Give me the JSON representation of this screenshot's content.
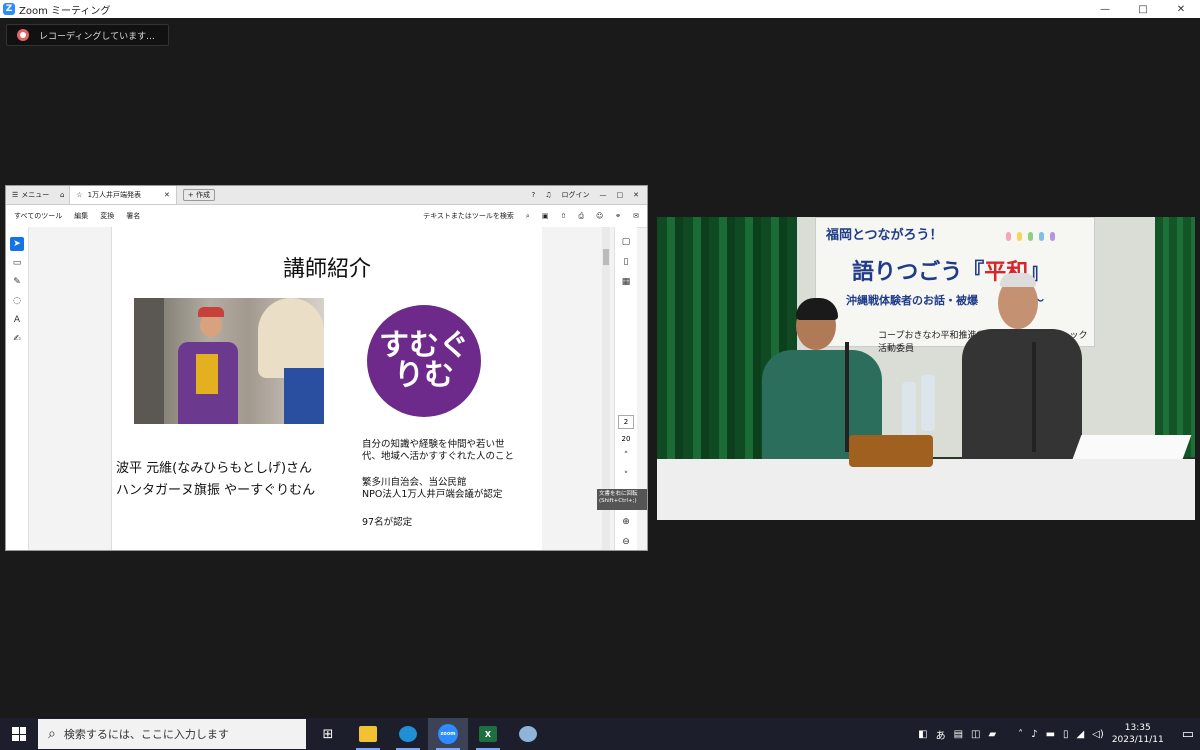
{
  "zoom": {
    "title": "Zoom ミーティング",
    "logo_letter": "Z",
    "recording_label": "レコーディングしています...",
    "controls": {
      "minimize": "—",
      "maximize": "□",
      "close": "✕"
    }
  },
  "pdf": {
    "tabs": {
      "menu_label": "メニュー",
      "doc_title": "1万人井戸端発表",
      "new_label": "作成",
      "login_label": "ログイン"
    },
    "toolbar": {
      "items": [
        "すべてのツール",
        "編集",
        "変換",
        "署名"
      ],
      "search_label": "テキストまたはツールを検索"
    },
    "page_nav": {
      "current": "2",
      "total": "20"
    },
    "tooltip": {
      "line1": "文書を右に回転",
      "line2": "(Shift+Ctrl+;)"
    }
  },
  "slide": {
    "title": "講師紹介",
    "name_line1": "波平 元維(なみひらもとしげ)さん",
    "name_line2": "ハンタガーヌ旗振 やーすぐりむん",
    "logo_text": "すむぐりむ",
    "desc_line1": "自分の知識や経験を仲間や若い世",
    "desc_line2": "代、地域へ活かすすぐれた人のこと",
    "org_line1": "繁多川自治会、当公民館",
    "org_line2": "NPO法人1万人井戸端会議が認定",
    "count_line": "97名が認定"
  },
  "video": {
    "banner_line1": "福岡とつながろう！",
    "banner_line2_prefix": "語りつごう『",
    "banner_line2_red": "平和",
    "banner_line2_suffix": "』",
    "banner_line3": "沖縄戦体験者のお話・被爆　　　読劇～",
    "banner_line4": "コープおきなわ平和推進委員会/エフコー　　　ック活動委員"
  },
  "taskbar": {
    "search_placeholder": "検索するには、ここに入力します",
    "apps": [
      "task-view",
      "file-explorer",
      "edge",
      "zoom",
      "excel",
      "paint"
    ],
    "zoom_label": "zoom",
    "excel_label": "X",
    "ime": "あ",
    "time": "13:35",
    "date": "2023/11/11"
  }
}
